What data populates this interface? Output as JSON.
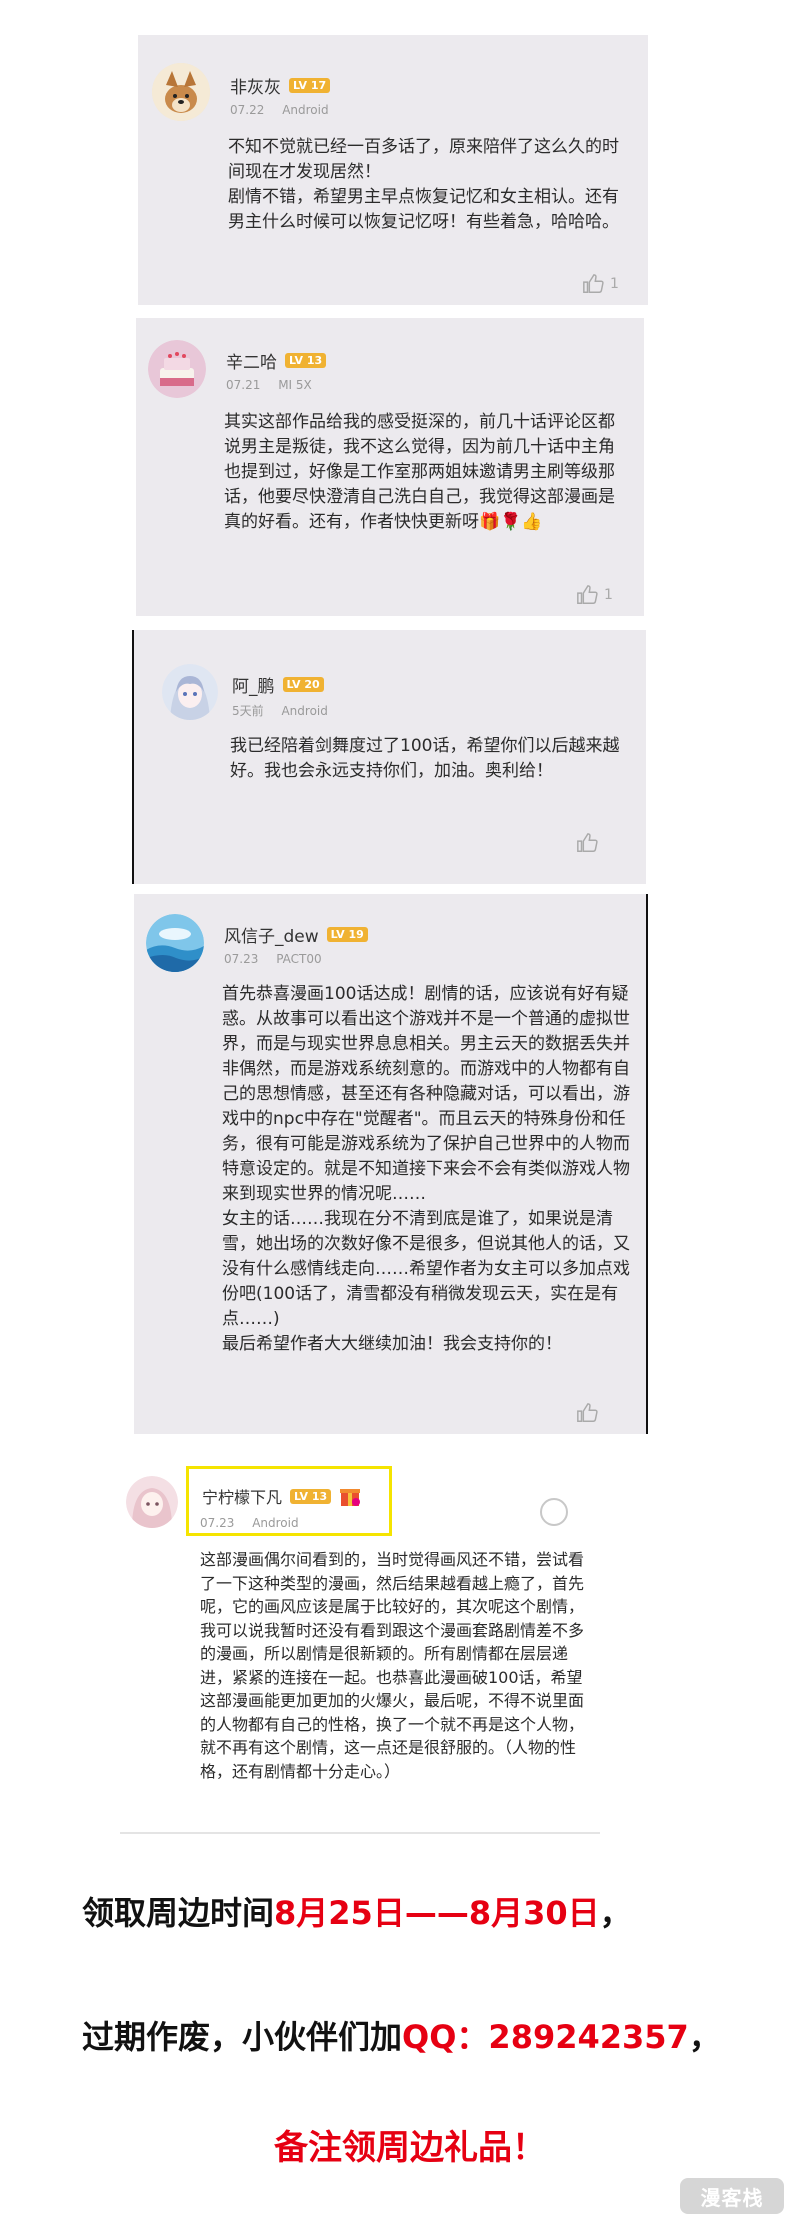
{
  "comments": [
    {
      "username": "非灰灰",
      "level": "LV 17",
      "date": "07.22",
      "device": "Android",
      "text": "不知不觉就已经一百多话了，原来陪伴了这么久的时间现在才发现居然！\n剧情不错，希望男主早点恢复记忆和女主相认。还有男主什么时候可以恢复记忆呀！有些着急，哈哈哈。",
      "likes": "1"
    },
    {
      "username": "辛二哈",
      "level": "LV 13",
      "date": "07.21",
      "device": "MI 5X",
      "text": "其实这部作品给我的感受挺深的，前几十话评论区都说男主是叛徒，我不这么觉得，因为前几十话中主角也提到过，好像是工作室那两姐妹邀请男主刷等级那话，他要尽快澄清自己洗白自己，我觉得这部漫画是真的好看。还有，作者快快更新呀🎁🌹👍",
      "likes": "1"
    },
    {
      "username": "阿_鹏",
      "level": "LV 20",
      "date": "5天前",
      "device": "Android",
      "text": "我已经陪着剑舞度过了100话，希望你们以后越来越好。我也会永远支持你们，加油。奥利给！",
      "likes": ""
    },
    {
      "username": "风信子_dew",
      "level": "LV 19",
      "date": "07.23",
      "device": "PACT00",
      "text": "首先恭喜漫画100话达成！剧情的话，应该说有好有疑惑。从故事可以看出这个游戏并不是一个普通的虚拟世界，而是与现实世界息息相关。男主云天的数据丢失并非偶然，而是游戏系统刻意的。而游戏中的人物都有自己的思想情感，甚至还有各种隐藏对话，可以看出，游戏中的npc中存在\"觉醒者\"。而且云天的特殊身份和任务，很有可能是游戏系统为了保护自己世界中的人物而特意设定的。就是不知道接下来会不会有类似游戏人物来到现实世界的情况呢……\n女主的话……我现在分不清到底是谁了，如果说是清雪，她出场的次数好像不是很多，但说其他人的话，又没有什么感情线走向……希望作者为女主可以多加点戏份吧(100话了，清雪都没有稍微发现云天，实在是有点……)\n最后希望作者大大继续加油！我会支持你的！",
      "likes": ""
    },
    {
      "username": "宁柠檬下凡",
      "level": "LV 13",
      "date": "07.23",
      "device": "Android",
      "text": "这部漫画偶尔间看到的，当时觉得画风还不错，尝试看了一下这种类型的漫画，然后结果越看越上瘾了，首先呢，它的画风应该是属于比较好的，其次呢这个剧情，我可以说我暂时还没有看到跟这个漫画套路剧情差不多的漫画，所以剧情是很新颖的。所有剧情都在层层递进，紧紧的连接在一起。也恭喜此漫画破100话，希望这部漫画能更加更加的火爆火，最后呢，不得不说里面的人物都有自己的性格，换了一个就不再是这个人物，就不再有这个剧情，这一点还是很舒服的。（人物的性格，还有剧情都十分走心。）",
      "likes": ""
    }
  ],
  "promo": {
    "line1_prefix": "领取周边时间",
    "line1_highlight": "8月25日——8月30日",
    "line1_suffix": "，",
    "line2_prefix": "过期作废，小伙伴们加",
    "line2_highlight": "QQ：289242357",
    "line2_suffix": "，",
    "line3": "备注领周边礼品！"
  },
  "watermark": "漫客栈",
  "colors": {
    "card_bg": "#eceaee",
    "level_badge": "#f0b232",
    "promo_red": "#e60012",
    "highlight_box": "#f5e400"
  },
  "icons": [
    "thumbs-up-icon",
    "gift-icon",
    "avatar-icon"
  ]
}
